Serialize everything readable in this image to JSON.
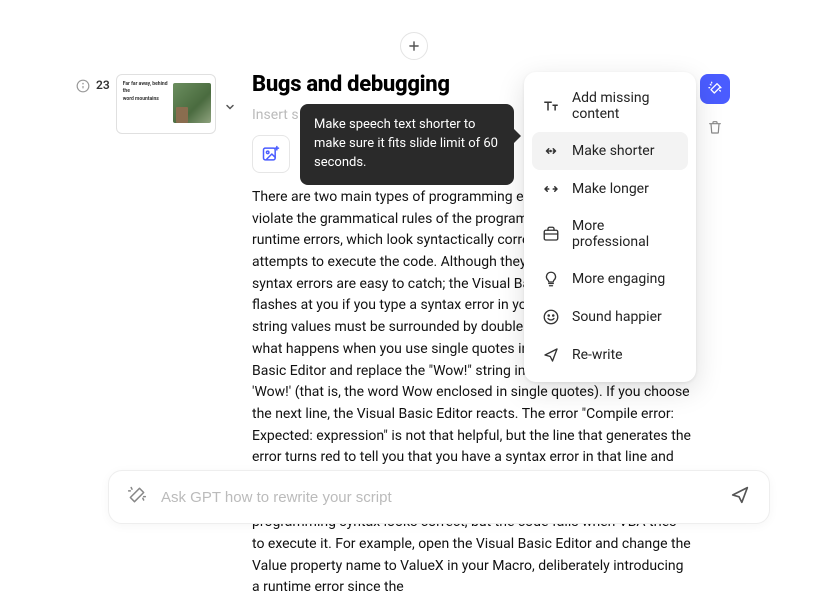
{
  "add_button": {
    "label": "+"
  },
  "sidebar": {
    "slide_number": "23",
    "thumb_title": "Far far away, behind the",
    "thumb_bold": "word mountains"
  },
  "main": {
    "title": "Bugs and debugging",
    "insert_hint": "Insert s",
    "body_text": "There are two main types of programming errors: syntax errors, which violate the grammatical rules of the programming language, and runtime errors, which look syntactically correct, but fail when VBA attempts to execute the code. Although they can be frustrating to fix, syntax errors are easy to catch; the Visual Basic Editor beeps and flashes at you if you type a syntax error in your code. For example, string values must be surrounded by double quotes in VBA. To find out what happens when you use single quotes instead, return to the Visual Basic Editor and replace the \"Wow!\" string in the code example with 'Wow!' (that is, the word Wow enclosed in single quotes). If you choose the next line, the Visual Basic Editor reacts. The error \"Compile error: Expected: expression\" is not that helpful, but the line that generates the error turns red to tell you that you have a syntax error in that line and as a result, this program will not run. Choose OK and change the text back to\"Wow!\". Runtime errors are harder to catch because the programming syntax looks correct, but the code fails when VBA tries to execute it. For example, open the Visual Basic Editor and change the Value property name to ValueX in your Macro, deliberately introducing a runtime error since the"
  },
  "tooltip": {
    "text": "Make speech text shorter to make sure it fits slide limit of 60 seconds."
  },
  "menu": {
    "items": [
      {
        "icon": "text-size-icon",
        "label": "Add missing content"
      },
      {
        "icon": "arrows-in-icon",
        "label": "Make shorter"
      },
      {
        "icon": "arrows-out-icon",
        "label": "Make longer"
      },
      {
        "icon": "briefcase-icon",
        "label": "More professional"
      },
      {
        "icon": "lightbulb-icon",
        "label": "More engaging"
      },
      {
        "icon": "smile-icon",
        "label": "Sound happier"
      },
      {
        "icon": "send-icon",
        "label": "Re-write"
      }
    ],
    "selected_index": 1
  },
  "prompt": {
    "placeholder": "Ask GPT how to rewrite your script"
  }
}
